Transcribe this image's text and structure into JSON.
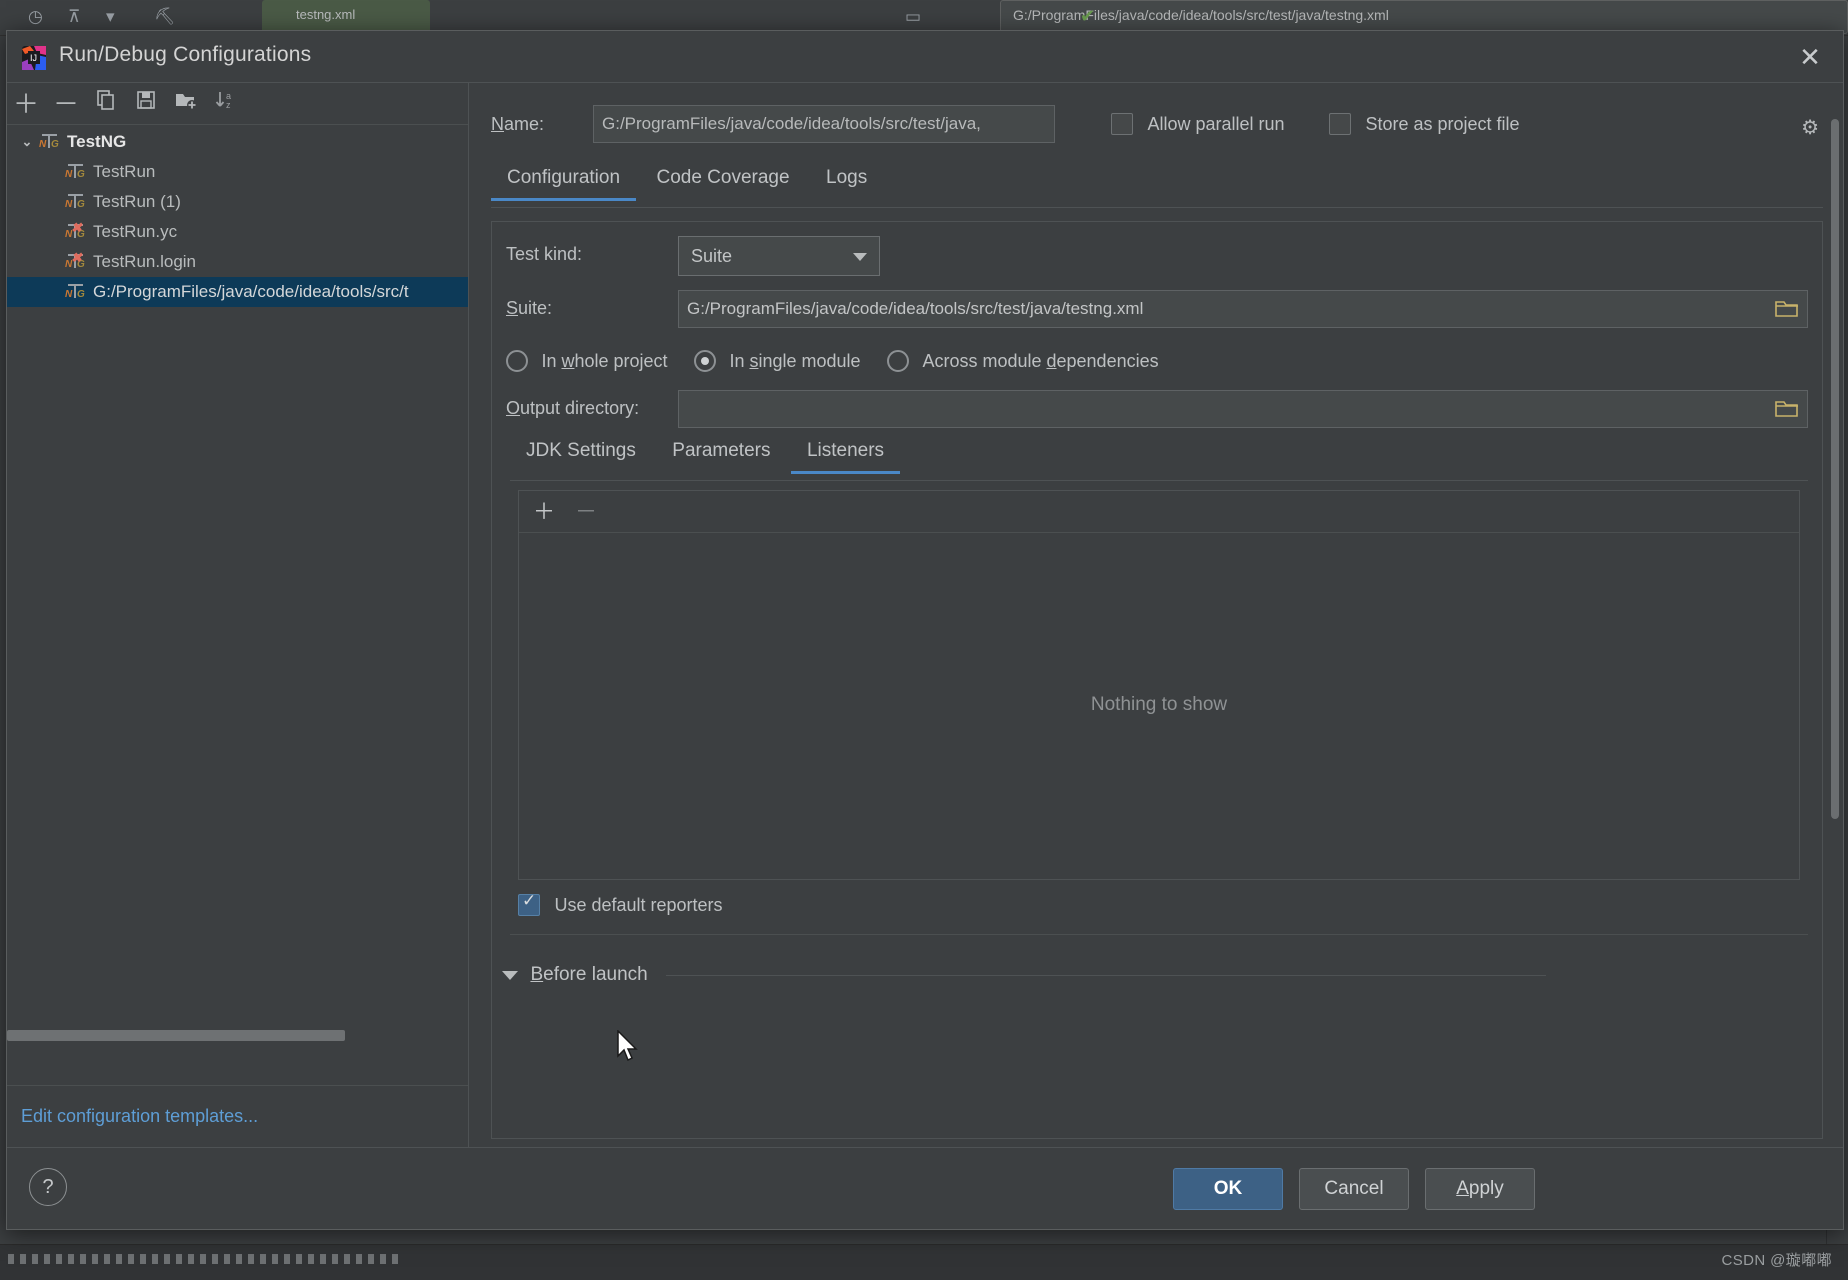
{
  "background": {
    "run_bar_text": "G:/ProgramFiles/java/code/idea/tools/src/test/java/testng.xml",
    "tab_chip_label": "testng.xml",
    "watermark": "CSDN @璇嘟嘟"
  },
  "dialog": {
    "title": "Run/Debug Configurations",
    "app_icon_name": "intellij-idea-icon",
    "close_label": "✕"
  },
  "left": {
    "toolbar": [
      {
        "name": "add-configuration-button",
        "glyph": "＋"
      },
      {
        "name": "remove-configuration-button",
        "glyph": "－"
      },
      {
        "name": "copy-configuration-button",
        "glyph": "❐"
      },
      {
        "name": "save-configuration-button",
        "glyph": "💾"
      },
      {
        "name": "move-to-folder-button",
        "glyph": "🗀"
      },
      {
        "name": "sort-configurations-button",
        "glyph": "↓"
      }
    ],
    "tree": [
      {
        "label": "TestNG",
        "level": 0,
        "kind": "group",
        "expanded": true,
        "selected": false,
        "error": false
      },
      {
        "label": "TestRun",
        "level": 1,
        "kind": "config",
        "selected": false,
        "error": false
      },
      {
        "label": "TestRun (1)",
        "level": 1,
        "kind": "config",
        "selected": false,
        "error": false
      },
      {
        "label": "TestRun.yc",
        "level": 1,
        "kind": "config",
        "selected": false,
        "error": true
      },
      {
        "label": "TestRun.login",
        "level": 1,
        "kind": "config",
        "selected": false,
        "error": true
      },
      {
        "label": "G:/ProgramFiles/java/code/idea/tools/src/t",
        "level": 1,
        "kind": "config",
        "selected": true,
        "error": false
      }
    ],
    "edit_templates_link": "Edit configuration templates..."
  },
  "form": {
    "name_label": "Name:",
    "name_value": "G:/ProgramFiles/java/code/idea/tools/src/test/java,",
    "allow_parallel_run_label": "Allow parallel run",
    "allow_parallel_run_checked": false,
    "store_as_project_file_label": "Store as project file",
    "store_as_project_file_checked": false,
    "gear_icon": "gear-icon",
    "top_tabs": [
      {
        "label": "Configuration",
        "active": true
      },
      {
        "label": "Code Coverage",
        "active": false
      },
      {
        "label": "Logs",
        "active": false
      }
    ],
    "test_kind_label": "Test kind:",
    "test_kind_value": "Suite",
    "suite_label": "Suite:",
    "suite_value": "G:/ProgramFiles/java/code/idea/tools/src/test/java/testng.xml",
    "scope_options": [
      {
        "label": "In whole project",
        "selected": false
      },
      {
        "label": "In single module",
        "selected": true
      },
      {
        "label": "Across module dependencies",
        "selected": false
      }
    ],
    "output_directory_label": "Output directory:",
    "output_directory_value": "",
    "inner_tabs": [
      {
        "label": "JDK Settings",
        "active": false
      },
      {
        "label": "Parameters",
        "active": false
      },
      {
        "label": "Listeners",
        "active": true
      }
    ],
    "listeners_toolbar": [
      {
        "name": "add-listener-button",
        "glyph": "＋",
        "enabled": true
      },
      {
        "name": "remove-listener-button",
        "glyph": "－",
        "enabled": false
      }
    ],
    "listeners_empty_text": "Nothing to show",
    "use_default_reporters_label": "Use default reporters",
    "use_default_reporters_checked": true,
    "before_launch_label": "Before launch"
  },
  "footer": {
    "help_label": "?",
    "ok_label": "OK",
    "cancel_label": "Cancel",
    "apply_label": "Apply"
  },
  "colors": {
    "accent": "#4a88c7",
    "selection": "#0d3a58",
    "primary_button": "#3d6185",
    "link": "#5e9ed6"
  }
}
